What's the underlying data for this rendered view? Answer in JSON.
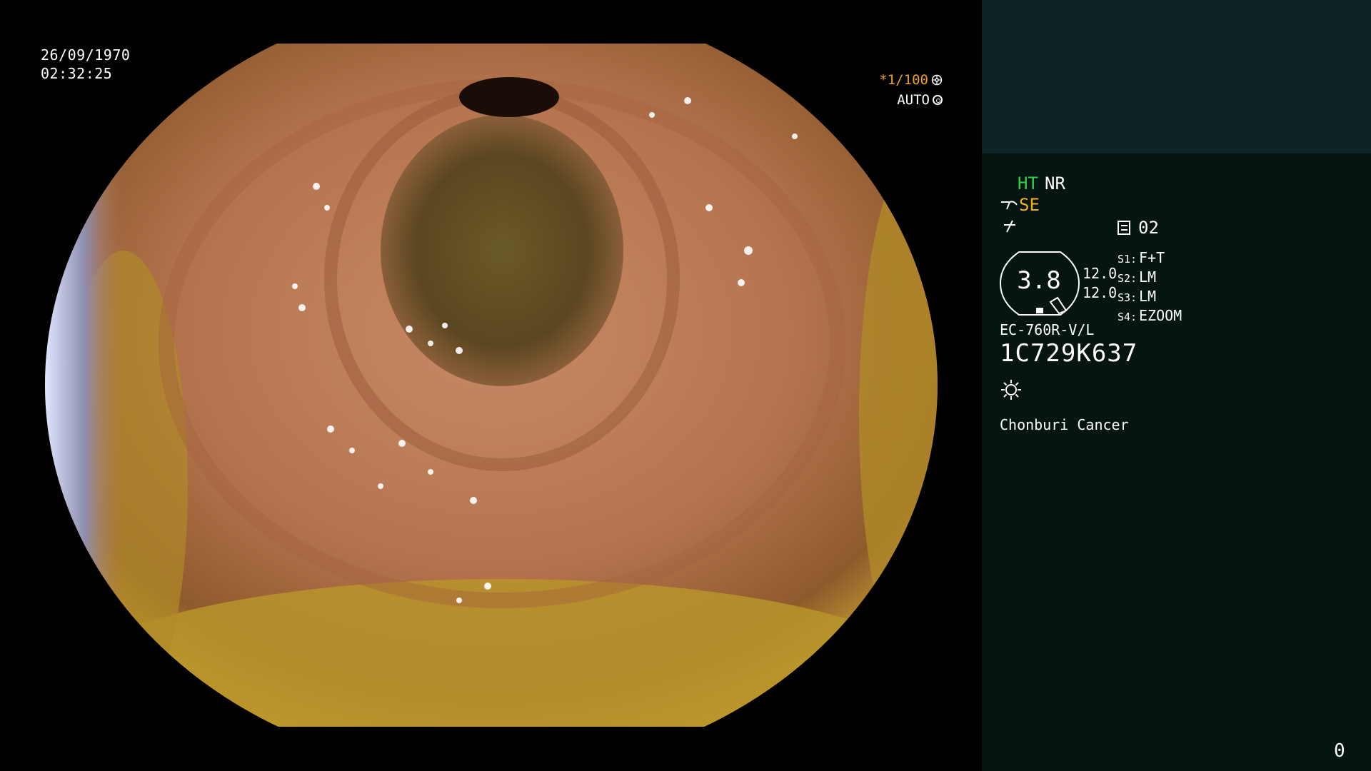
{
  "window": {
    "date": "26/09/1970",
    "time": "02:32:25"
  },
  "overlay": {
    "shutter_speed": "*1/100",
    "shutter_mode": "AUTO"
  },
  "side_panel": {
    "modes": {
      "ht": "HT",
      "nr": "NR",
      "se": "SE"
    },
    "disk_number": "02",
    "magnification": "3.8",
    "exposure": [
      "12.0",
      "12.0"
    ],
    "switches": [
      {
        "key": "S1:",
        "value": "F+T"
      },
      {
        "key": "S2:",
        "value": "LM"
      },
      {
        "key": "S3:",
        "value": "LM"
      },
      {
        "key": "S4:",
        "value": "EZOOM"
      }
    ],
    "scope_model": "EC-760R-V/L",
    "serial_number": "1C729K637",
    "hospital": "Chonburi Cancer",
    "counter": "0"
  },
  "colors": {
    "ht_green": "#33d14a",
    "se_orange": "#f0b020",
    "shutter_orange": "#e8a030",
    "panel_bg": "#061412",
    "panel_top_bg": "#0d2426"
  },
  "icons": [
    "gear-icon",
    "ring-icon",
    "scope-tip-icon",
    "enhance-icon",
    "disk-icon",
    "light-icon"
  ]
}
